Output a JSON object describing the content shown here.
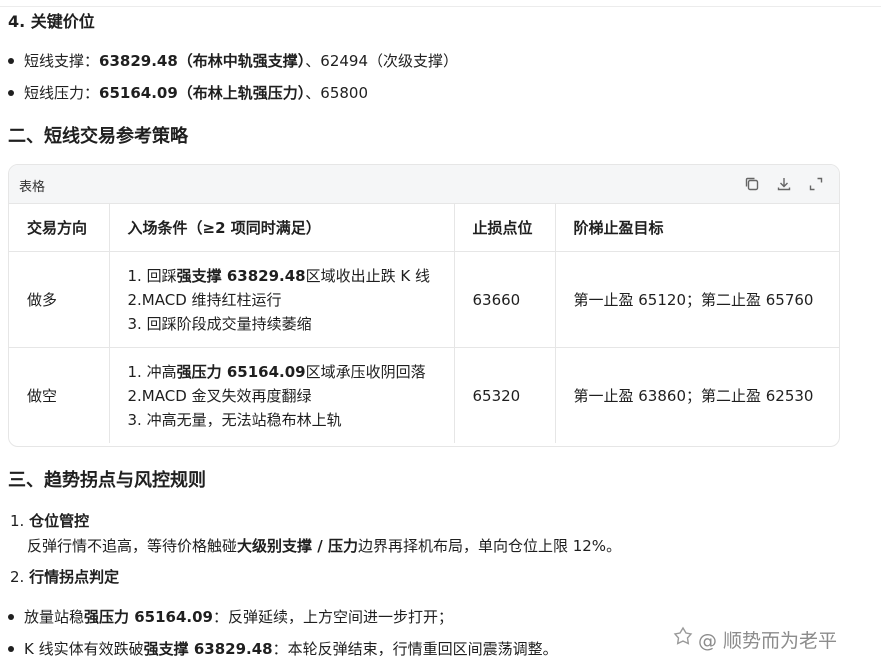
{
  "section4": {
    "heading": "4. 关键价位",
    "items": [
      {
        "prefix": "短线支撑：",
        "bold": "63829.48（布林中轨强支撑）",
        "suffix": "、62494（次级支撑）"
      },
      {
        "prefix": "短线压力：",
        "bold": "65164.09（布林上轨强压力）",
        "suffix": "、65800"
      }
    ]
  },
  "section2": {
    "heading": "二、短线交易参考策略",
    "table": {
      "title": "表格",
      "headers": [
        "交易方向",
        "入场条件（≥2 项同时满足）",
        "止损点位",
        "阶梯止盈目标"
      ],
      "rows": [
        {
          "direction": "做多",
          "conditions": [
            {
              "pre": "1. 回踩",
              "bold": "强支撑 63829.48",
              "post": "区域收出止跌 K 线"
            },
            {
              "pre": "2.MACD 维持红柱运行",
              "bold": "",
              "post": ""
            },
            {
              "pre": "3. 回踩阶段成交量持续萎缩",
              "bold": "",
              "post": ""
            }
          ],
          "stop": "63660",
          "target": "第一止盈 65120；第二止盈 65760"
        },
        {
          "direction": "做空",
          "conditions": [
            {
              "pre": "1. 冲高",
              "bold": "强压力 65164.09",
              "post": "区域承压收阴回落"
            },
            {
              "pre": "2.MACD 金叉失效再度翻绿",
              "bold": "",
              "post": ""
            },
            {
              "pre": "3. 冲高无量，无法站稳布林上轨",
              "bold": "",
              "post": ""
            }
          ],
          "stop": "65320",
          "target": "第一止盈 63860；第二止盈 62530"
        }
      ]
    }
  },
  "section3": {
    "heading": "三、趋势拐点与风控规则",
    "item1": {
      "num": "1.",
      "title": "仓位管控",
      "text_pre": "反弹行情不追高，等待价格触碰",
      "text_bold": "大级别支撑 / 压力",
      "text_post": "边界再择机布局，单向仓位上限 12%。"
    },
    "item2": {
      "num": "2.",
      "title": "行情拐点判定",
      "bullets": [
        {
          "pre": "放量站稳",
          "bold": "强压力 65164.09",
          "post": "：反弹延续，上方空间进一步打开；"
        },
        {
          "pre": "K 线实体有效跌破",
          "bold": "强支撑 63829.48",
          "post": "：本轮反弹结束，行情重回区间震荡调整。"
        }
      ]
    }
  },
  "watermark": "@ 顺势而为老平"
}
